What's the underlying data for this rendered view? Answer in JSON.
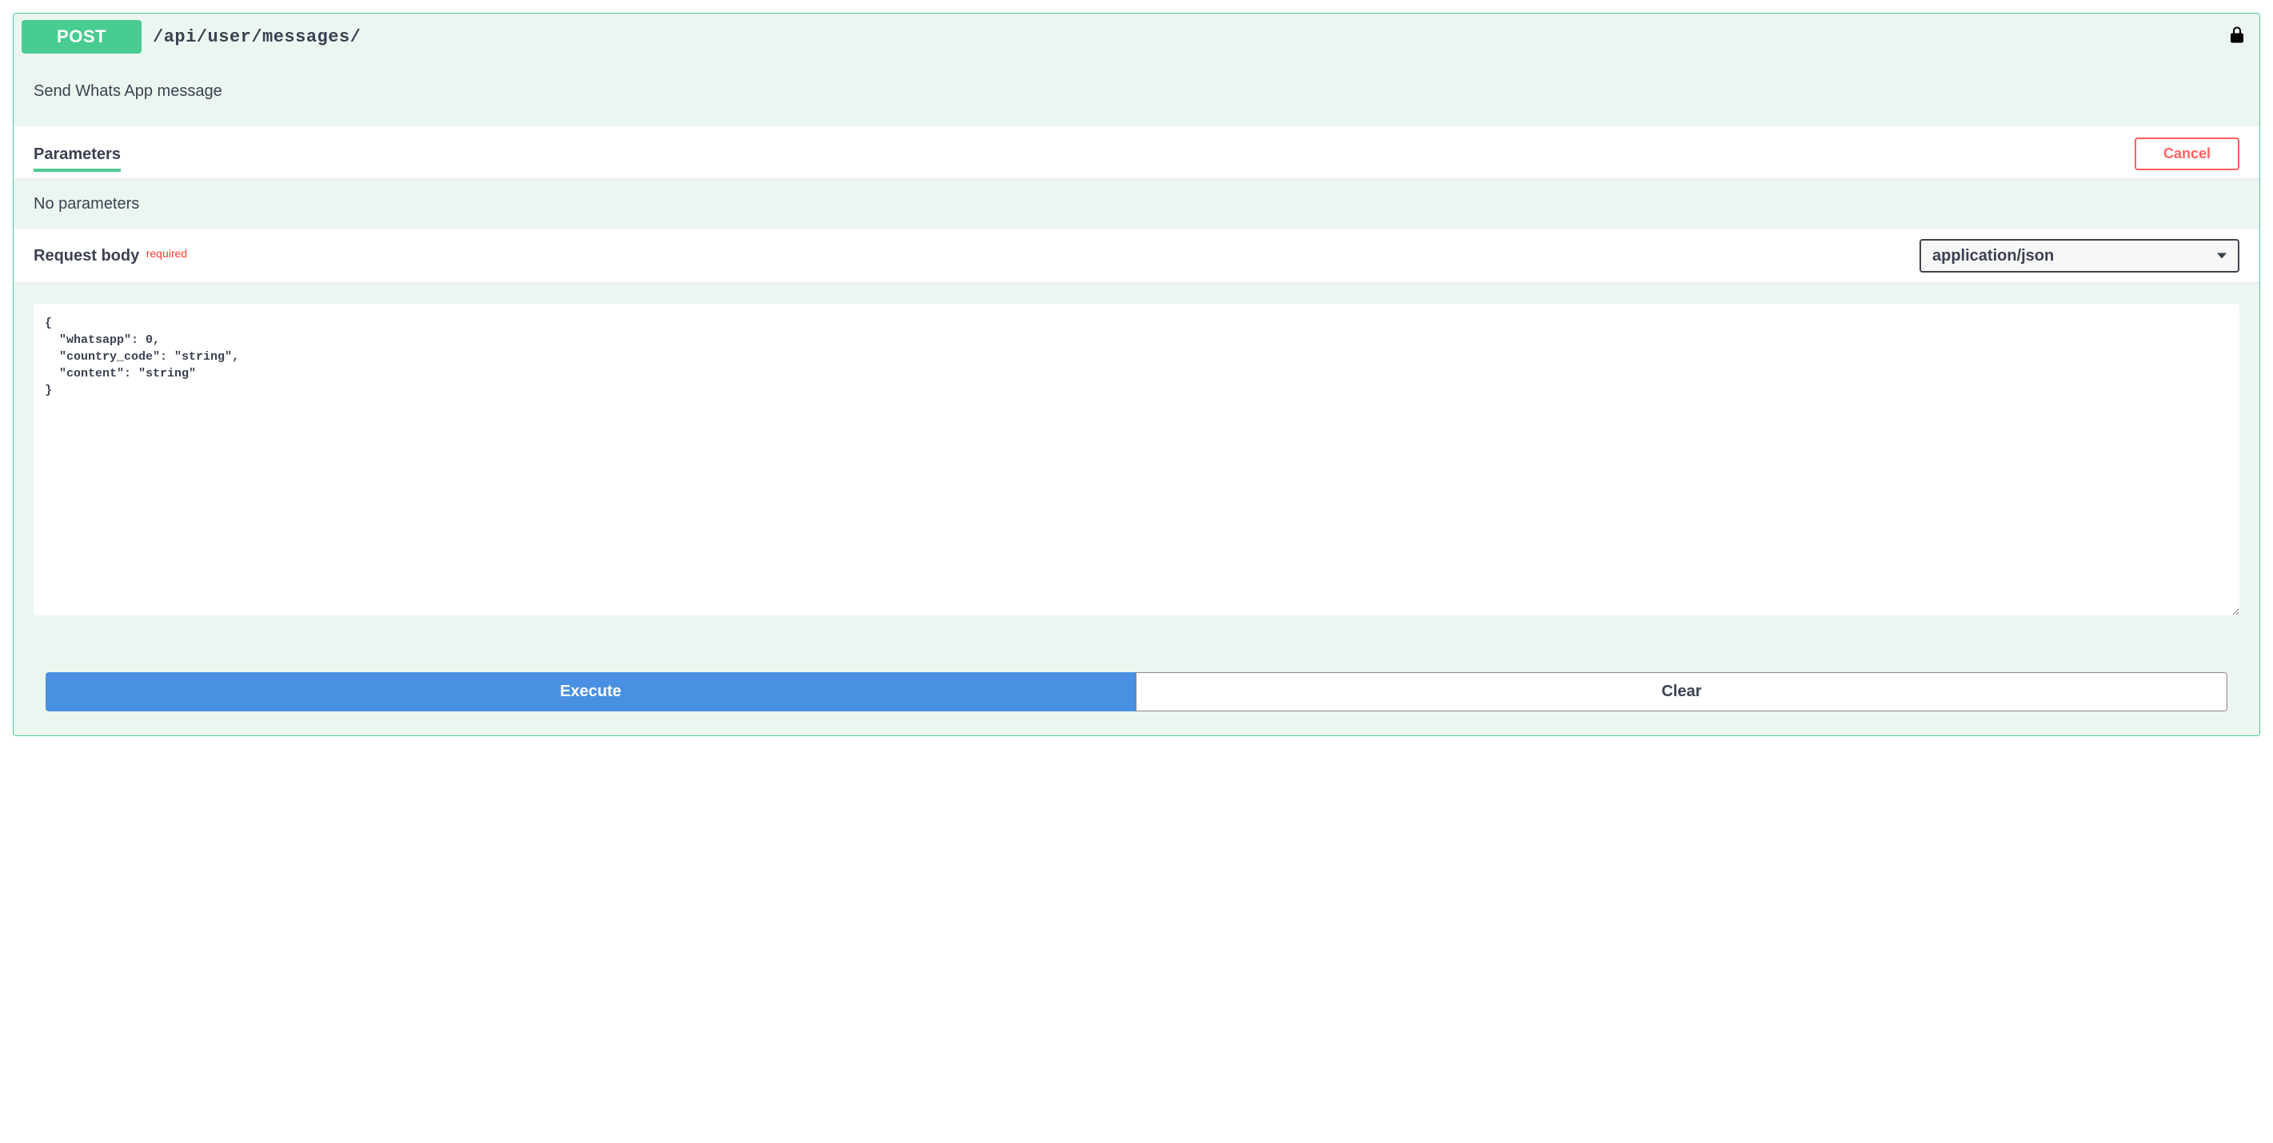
{
  "method": "POST",
  "path": "/api/user/messages/",
  "description": "Send Whats App message",
  "parameters": {
    "header_label": "Parameters",
    "cancel_label": "Cancel",
    "empty_text": "No parameters"
  },
  "request_body": {
    "header_label": "Request body",
    "required_label": "required",
    "content_type": "application/json",
    "body_value": "{\n  \"whatsapp\": 0,\n  \"country_code\": \"string\",\n  \"content\": \"string\"\n}"
  },
  "actions": {
    "execute_label": "Execute",
    "clear_label": "Clear"
  }
}
